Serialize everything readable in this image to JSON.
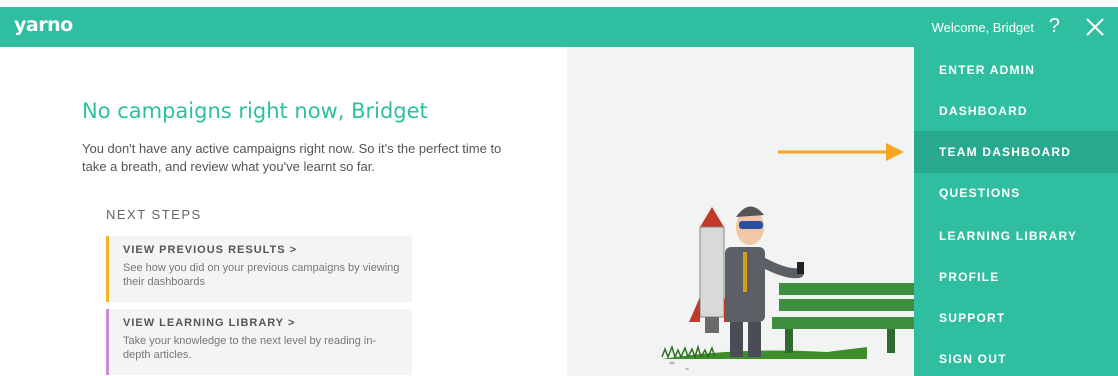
{
  "header": {
    "logo": "yarno",
    "welcome": "Welcome, Bridget",
    "help": "?"
  },
  "main": {
    "title": "No campaigns right now, Bridget",
    "intro": "You don't have any active campaigns right now. So it's the perfect time to take a breath, and review what you've learnt so far.",
    "steps_heading": "NEXT STEPS",
    "cards": [
      {
        "title": "VIEW PREVIOUS RESULTS >",
        "desc": "See how you did on your previous campaigns by viewing their dashboards"
      },
      {
        "title": "VIEW LEARNING LIBRARY >",
        "desc": "Take your knowledge to the next level by reading in-depth articles."
      }
    ]
  },
  "menu": {
    "items": [
      {
        "label": "ENTER ADMIN"
      },
      {
        "label": "DASHBOARD"
      },
      {
        "label": "TEAM DASHBOARD"
      },
      {
        "label": "QUESTIONS"
      },
      {
        "label": "LEARNING LIBRARY"
      },
      {
        "label": "PROFILE"
      },
      {
        "label": "SUPPORT"
      },
      {
        "label": "SIGN OUT"
      }
    ],
    "active_index": 2
  },
  "colors": {
    "brand": "#2fbfa0",
    "active": "#28a98e",
    "arrow": "#f5a623",
    "card1_accent": "#f5b325",
    "card2_accent": "#c98bd6"
  },
  "icons": {
    "help": "question-mark-icon",
    "close": "close-icon",
    "arrow": "arrow-right-icon"
  }
}
